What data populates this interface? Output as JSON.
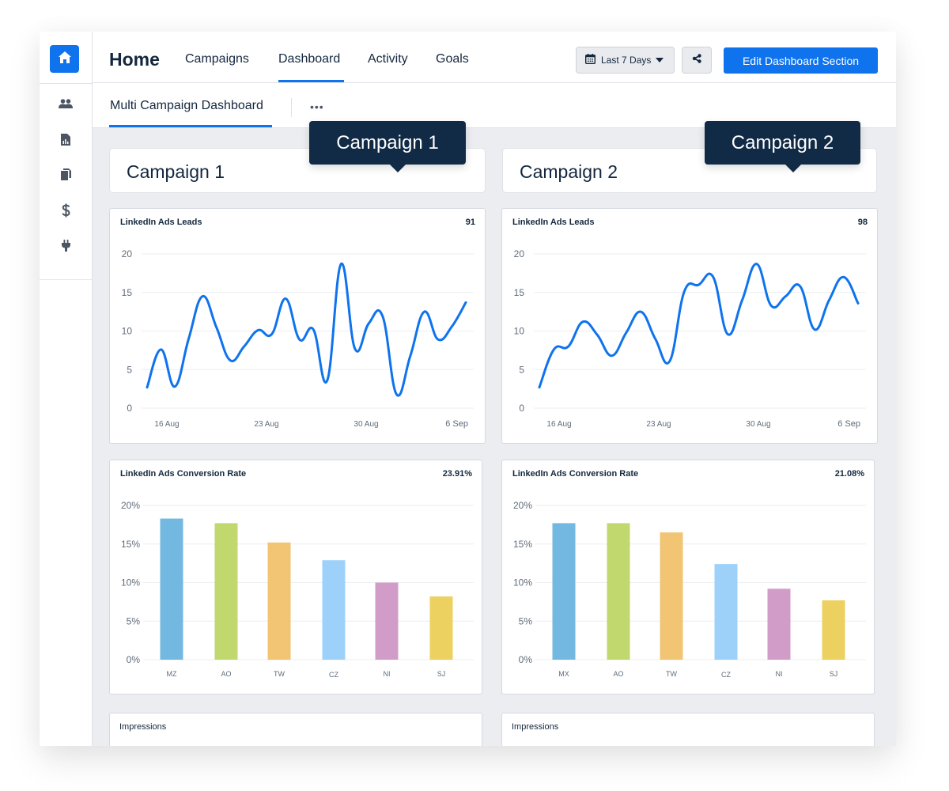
{
  "sidebar": {
    "home_icon": "home-icon",
    "items": [
      {
        "name": "users",
        "icon": "users-icon"
      },
      {
        "name": "reports",
        "icon": "report-icon"
      },
      {
        "name": "documents",
        "icon": "copy-icon"
      },
      {
        "name": "billing",
        "icon": "dollar-icon"
      },
      {
        "name": "integrations",
        "icon": "plug-icon"
      }
    ]
  },
  "header": {
    "title": "Home",
    "tabs": [
      {
        "label": "Campaigns",
        "active": false
      },
      {
        "label": "Dashboard",
        "active": true
      },
      {
        "label": "Activity",
        "active": false
      },
      {
        "label": "Goals",
        "active": false
      }
    ],
    "date_range": "Last 7 Days",
    "share_icon": "share-icon",
    "edit_button": "Edit Dashboard Section",
    "accent": "#0f73ee"
  },
  "subbar": {
    "tab": "Multi Campaign Dashboard",
    "more": "•••"
  },
  "campaigns": [
    {
      "title": "Campaign 1",
      "tooltip": "Campaign 1",
      "leads_widget": {
        "title": "LinkedIn Ads Leads",
        "value": "91"
      },
      "conversion_widget": {
        "title": "LinkedIn Ads Conversion Rate",
        "value": "23.91%"
      },
      "impressions_widget": {
        "title": "Impressions"
      }
    },
    {
      "title": "Campaign 2",
      "tooltip": "Campaign 2",
      "leads_widget": {
        "title": "LinkedIn Ads Leads",
        "value": "98"
      },
      "conversion_widget": {
        "title": "LinkedIn Ads Conversion Rate",
        "value": "21.08%"
      },
      "impressions_widget": {
        "title": "Impressions"
      }
    }
  ],
  "chart_data": [
    {
      "type": "line",
      "title": "LinkedIn Ads Leads",
      "campaign": "Campaign 1",
      "x_tick_labels": [
        "16 Aug",
        "23 Aug",
        "30 Aug",
        "6 Sep"
      ],
      "y_ticks": [
        0,
        5,
        10,
        15,
        20
      ],
      "ylim": [
        0,
        20
      ],
      "grid": true,
      "line_color": "#0f73ee",
      "values": [
        2.7,
        7.6,
        2.8,
        9.0,
        14.5,
        10.5,
        6.2,
        8.0,
        10.1,
        9.6,
        14.2,
        8.9,
        10.2,
        3.6,
        18.7,
        7.7,
        11.0,
        11.9,
        1.8,
        6.8,
        12.5,
        8.9,
        10.6,
        13.7
      ]
    },
    {
      "type": "line",
      "title": "LinkedIn Ads Leads",
      "campaign": "Campaign 2",
      "x_tick_labels": [
        "16 Aug",
        "23 Aug",
        "30 Aug",
        "6 Sep"
      ],
      "y_ticks": [
        0,
        5,
        10,
        15,
        20
      ],
      "ylim": [
        0,
        20
      ],
      "grid": true,
      "line_color": "#0f73ee",
      "values": [
        2.7,
        7.6,
        8.0,
        11.2,
        9.5,
        6.8,
        9.8,
        12.5,
        9.0,
        6.1,
        15.1,
        16.0,
        17.0,
        9.6,
        14.0,
        18.7,
        13.3,
        14.5,
        15.8,
        10.2,
        14.0,
        17.0,
        13.6
      ]
    },
    {
      "type": "bar",
      "title": "LinkedIn Ads Conversion Rate",
      "campaign": "Campaign 1",
      "categories": [
        "MZ",
        "AO",
        "TW",
        "CZ",
        "NI",
        "SJ"
      ],
      "values": [
        18.3,
        17.7,
        15.2,
        12.9,
        10.0,
        8.2
      ],
      "colors": [
        "#72b8e1",
        "#c0d86d",
        "#f1c574",
        "#9dd1fa",
        "#d29cc8",
        "#ecd160"
      ],
      "y_tick_labels": [
        "0%",
        "5%",
        "10%",
        "15%",
        "20%"
      ],
      "ylim": [
        0,
        20
      ],
      "grid": true
    },
    {
      "type": "bar",
      "title": "LinkedIn Ads Conversion Rate",
      "campaign": "Campaign 2",
      "categories": [
        "MX",
        "AO",
        "TW",
        "CZ",
        "NI",
        "SJ"
      ],
      "values": [
        17.7,
        17.7,
        16.5,
        12.4,
        9.2,
        7.7
      ],
      "colors": [
        "#72b8e1",
        "#c0d86d",
        "#f1c574",
        "#9dd1fa",
        "#d29cc8",
        "#ecd160"
      ],
      "y_tick_labels": [
        "0%",
        "5%",
        "10%",
        "15%",
        "20%"
      ],
      "ylim": [
        0,
        20
      ],
      "grid": true
    }
  ]
}
